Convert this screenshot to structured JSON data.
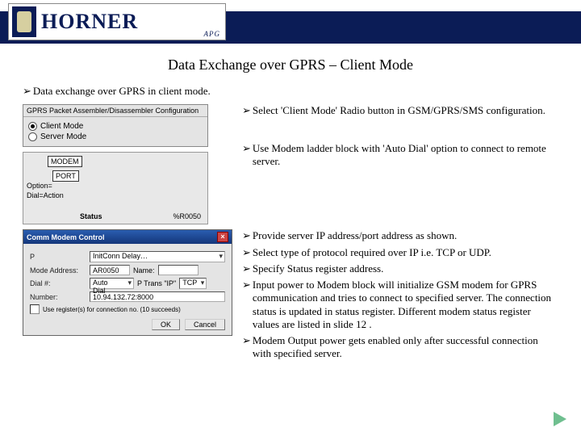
{
  "brand": {
    "name": "HORNER",
    "sub": "APG"
  },
  "title": "Data Exchange over GPRS – Client Mode",
  "intro": "Data exchange over GPRS in client mode.",
  "cfg": {
    "panel_title": "GPRS Packet Assembler/Disassembler Configuration",
    "opt_client": "Client Mode",
    "opt_server": "Server Mode"
  },
  "ladder": {
    "modem": "MODEM",
    "port": "PORT",
    "opt": "Option=",
    "dial": "Dial=",
    "action": "Action",
    "status": "Status",
    "reg": "%R0050"
  },
  "dlg": {
    "title": "Comm Modem Control",
    "p_label": "P",
    "p_value": "InitConn Delay…",
    "mode_label": "Mode Address:",
    "mode_value": "AR0050",
    "name_label": "Name:",
    "dial_label": "Dial #:",
    "dial_value": "Auto Dial",
    "proto_label": "P Trans \"IP\"",
    "proto_value": "TCP",
    "num_label": "Number:",
    "num_value": "10.94.132.72:8000",
    "chk_label": "Use register(s) for connection no. (10 succeeds)",
    "ok": "OK",
    "cancel": "Cancel"
  },
  "pts_top": [
    "Select 'Client Mode' Radio button in GSM/GPRS/SMS configuration.",
    " Use Modem ladder block with 'Auto Dial' option to connect to remote server."
  ],
  "pts_bot": [
    "Provide server IP address/port address as shown.",
    "Select type of protocol required over IP i.e. TCP or UDP.",
    "Specify Status register address.",
    "Input power to Modem block will initialize GSM modem for GPRS communication and tries to connect to specified server. The connection status is updated in status register. Different modem status register values are listed in slide 12 .",
    "Modem Output power gets enabled only after successful connection with specified server."
  ]
}
